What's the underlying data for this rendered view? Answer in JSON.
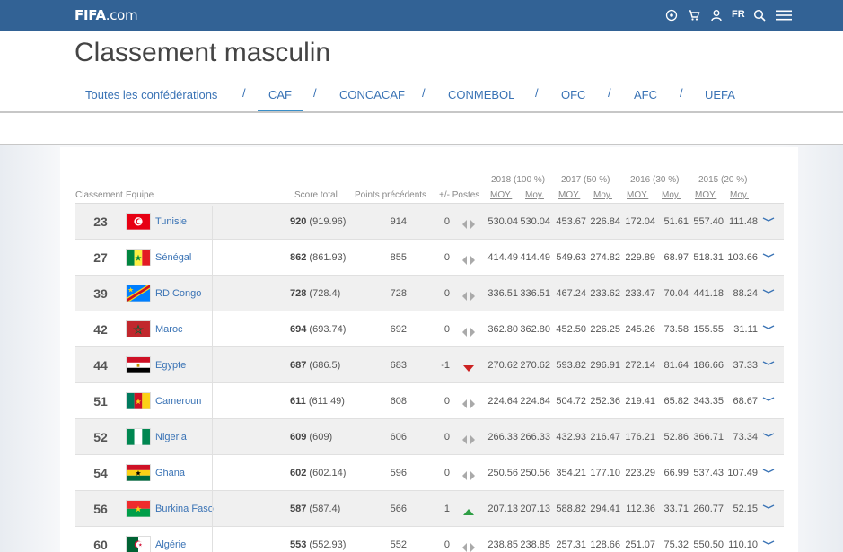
{
  "header": {
    "logo_bold": "FIFA",
    "logo_rest": ".com",
    "lang": "FR",
    "icons": [
      "football-icon",
      "cart-icon",
      "user-icon",
      "search-icon",
      "menu-icon"
    ]
  },
  "page": {
    "title": "Classement masculin"
  },
  "tabs": [
    {
      "label": "Toutes les confédérations",
      "active": false
    },
    {
      "label": "CAF",
      "active": true
    },
    {
      "label": "CONCACAF",
      "active": false
    },
    {
      "label": "CONMEBOL",
      "active": false
    },
    {
      "label": "OFC",
      "active": false
    },
    {
      "label": "AFC",
      "active": false
    },
    {
      "label": "UEFA",
      "active": false
    }
  ],
  "tab_separator": "/",
  "table": {
    "year_headers": [
      "2018 (100 %)",
      "2017 (50 %)",
      "2016 (30 %)",
      "2015 (20 %)"
    ],
    "columns": {
      "rank": "Classement",
      "team": "Equipe",
      "score": "Score total",
      "prev": "Points précédents",
      "diff": "+/- Postes",
      "moy": "MOY.",
      "moy2": "Moy."
    },
    "rows": [
      {
        "rank": "23",
        "team": "Tunisie",
        "flag": "tunisia",
        "score": "920",
        "score_exact": "(919.96)",
        "prev": "914",
        "diff": "0",
        "move": "same",
        "vals": [
          "530.04",
          "530.04",
          "453.67",
          "226.84",
          "172.04",
          "51.61",
          "557.40",
          "111.48"
        ]
      },
      {
        "rank": "27",
        "team": "Sénégal",
        "flag": "senegal",
        "score": "862",
        "score_exact": "(861.93)",
        "prev": "855",
        "diff": "0",
        "move": "same",
        "vals": [
          "414.49",
          "414.49",
          "549.63",
          "274.82",
          "229.89",
          "68.97",
          "518.31",
          "103.66"
        ]
      },
      {
        "rank": "39",
        "team": "RD Congo",
        "flag": "drc",
        "score": "728",
        "score_exact": "(728.4)",
        "prev": "728",
        "diff": "0",
        "move": "same",
        "vals": [
          "336.51",
          "336.51",
          "467.24",
          "233.62",
          "233.47",
          "70.04",
          "441.18",
          "88.24"
        ]
      },
      {
        "rank": "42",
        "team": "Maroc",
        "flag": "morocco",
        "score": "694",
        "score_exact": "(693.74)",
        "prev": "692",
        "diff": "0",
        "move": "same",
        "vals": [
          "362.80",
          "362.80",
          "452.50",
          "226.25",
          "245.26",
          "73.58",
          "155.55",
          "31.11"
        ]
      },
      {
        "rank": "44",
        "team": "Egypte",
        "flag": "egypt",
        "score": "687",
        "score_exact": "(686.5)",
        "prev": "683",
        "diff": "-1",
        "move": "down",
        "vals": [
          "270.62",
          "270.62",
          "593.82",
          "296.91",
          "272.14",
          "81.64",
          "186.66",
          "37.33"
        ]
      },
      {
        "rank": "51",
        "team": "Cameroun",
        "flag": "cameroon",
        "score": "611",
        "score_exact": "(611.49)",
        "prev": "608",
        "diff": "0",
        "move": "same",
        "vals": [
          "224.64",
          "224.64",
          "504.72",
          "252.36",
          "219.41",
          "65.82",
          "343.35",
          "68.67"
        ]
      },
      {
        "rank": "52",
        "team": "Nigeria",
        "flag": "nigeria",
        "score": "609",
        "score_exact": "(609)",
        "prev": "606",
        "diff": "0",
        "move": "same",
        "vals": [
          "266.33",
          "266.33",
          "432.93",
          "216.47",
          "176.21",
          "52.86",
          "366.71",
          "73.34"
        ]
      },
      {
        "rank": "54",
        "team": "Ghana",
        "flag": "ghana",
        "score": "602",
        "score_exact": "(602.14)",
        "prev": "596",
        "diff": "0",
        "move": "same",
        "vals": [
          "250.56",
          "250.56",
          "354.21",
          "177.10",
          "223.29",
          "66.99",
          "537.43",
          "107.49"
        ]
      },
      {
        "rank": "56",
        "team": "Burkina Faso",
        "flag": "burkina",
        "score": "587",
        "score_exact": "(587.4)",
        "prev": "566",
        "diff": "1",
        "move": "up",
        "vals": [
          "207.13",
          "207.13",
          "588.82",
          "294.41",
          "112.36",
          "33.71",
          "260.77",
          "52.15"
        ]
      },
      {
        "rank": "60",
        "team": "Algérie",
        "flag": "algeria",
        "score": "553",
        "score_exact": "(552.93)",
        "prev": "552",
        "diff": "0",
        "move": "same",
        "vals": [
          "238.85",
          "238.85",
          "257.31",
          "128.66",
          "251.07",
          "75.32",
          "550.50",
          "110.10"
        ]
      }
    ]
  },
  "colors": {
    "header_bg": "#326295",
    "link": "#3a73b5",
    "up": "#2e9e45",
    "down": "#cc2222"
  }
}
